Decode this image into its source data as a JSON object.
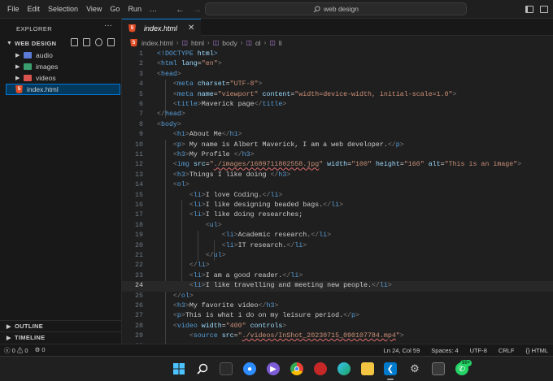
{
  "menu": [
    "File",
    "Edit",
    "Selection",
    "View",
    "Go",
    "Run",
    "…"
  ],
  "search": {
    "text": "web design"
  },
  "sidebar": {
    "title": "EXPLORER",
    "more": "···",
    "workspace": "WEB DESIGN",
    "items": [
      {
        "label": "audio"
      },
      {
        "label": "images"
      },
      {
        "label": "videos"
      },
      {
        "label": "index.html"
      }
    ],
    "outline": "OUTLINE",
    "timeline": "TIMELINE"
  },
  "editor": {
    "tab_title": "index.html",
    "breadcrumb": [
      "index.html",
      "html",
      "body",
      "ol",
      "li"
    ]
  },
  "code": [
    {
      "n": "1",
      "html": "<span class=\"tag\">&lt;!DOCTYPE</span> <span class=\"attr\">html</span><span class=\"tag\">&gt;</span>"
    },
    {
      "n": "2",
      "html": "<span class=\"punc\">&lt;</span><span class=\"tag\">html</span> <span class=\"attr\">lang</span>=<span class=\"str\">\"en\"</span><span class=\"punc\">&gt;</span>"
    },
    {
      "n": "3",
      "html": "<span class=\"punc\">&lt;</span><span class=\"tag\">head</span><span class=\"punc\">&gt;</span>"
    },
    {
      "n": "4",
      "html": "    <span class=\"punc\">&lt;</span><span class=\"tag\">meta</span> <span class=\"attr\">charset</span>=<span class=\"str\">\"UTF-8\"</span><span class=\"punc\">&gt;</span>"
    },
    {
      "n": "5",
      "html": "    <span class=\"punc\">&lt;</span><span class=\"tag\">meta</span> <span class=\"attr\">name</span>=<span class=\"str\">\"viewport\"</span> <span class=\"attr\">content</span>=<span class=\"str\">\"width=device-width, initial-scale=1.0\"</span><span class=\"punc\">&gt;</span>"
    },
    {
      "n": "6",
      "html": "    <span class=\"punc\">&lt;</span><span class=\"tag\">title</span><span class=\"punc\">&gt;</span>Maverick page<span class=\"punc\">&lt;/</span><span class=\"tag\">title</span><span class=\"punc\">&gt;</span>"
    },
    {
      "n": "7",
      "html": "<span class=\"punc\">&lt;/</span><span class=\"tag\">head</span><span class=\"punc\">&gt;</span>"
    },
    {
      "n": "8",
      "html": "<span class=\"punc\">&lt;</span><span class=\"tag\">body</span><span class=\"punc\">&gt;</span>"
    },
    {
      "n": "9",
      "html": "    <span class=\"punc\">&lt;</span><span class=\"tag\">h1</span><span class=\"punc\">&gt;</span>About Me<span class=\"punc\">&lt;/</span><span class=\"tag\">h1</span><span class=\"punc\">&gt;</span>"
    },
    {
      "n": "10",
      "html": "    <span class=\"punc\">&lt;</span><span class=\"tag\">p</span><span class=\"punc\">&gt;</span> My name is Albert Maverick, I am a web developer.<span class=\"punc\">&lt;/</span><span class=\"tag\">p</span><span class=\"punc\">&gt;</span>"
    },
    {
      "n": "11",
      "html": "    <span class=\"punc\">&lt;</span><span class=\"tag\">h3</span><span class=\"punc\">&gt;</span>My Profile <span class=\"punc\">&lt;/</span><span class=\"tag\">h3</span><span class=\"punc\">&gt;</span>"
    },
    {
      "n": "12",
      "html": "    <span class=\"punc\">&lt;</span><span class=\"tag\">img</span> <span class=\"attr\">src</span>=<span class=\"str\">\"<span class=\"wavy\">./images/1689711802558.jpg</span>\"</span> <span class=\"attr\">width</span>=<span class=\"str\">\"100\"</span> <span class=\"attr\">height</span>=<span class=\"str\">\"160\"</span> <span class=\"attr\">alt</span>=<span class=\"str\">\"This is an image\"</span><span class=\"punc\">&gt;</span>"
    },
    {
      "n": "13",
      "html": "    <span class=\"punc\">&lt;</span><span class=\"tag\">h3</span><span class=\"punc\">&gt;</span>Things I like doing <span class=\"punc\">&lt;/</span><span class=\"tag\">h3</span><span class=\"punc\">&gt;</span>"
    },
    {
      "n": "14",
      "html": "    <span class=\"punc\">&lt;</span><span class=\"tag\">ol</span><span class=\"punc\">&gt;</span>"
    },
    {
      "n": "15",
      "html": "        <span class=\"punc\">&lt;</span><span class=\"tag\">li</span><span class=\"punc\">&gt;</span>I love Coding.<span class=\"punc\">&lt;/</span><span class=\"tag\">li</span><span class=\"punc\">&gt;</span>"
    },
    {
      "n": "16",
      "html": "        <span class=\"punc\">&lt;</span><span class=\"tag\">li</span><span class=\"punc\">&gt;</span>I like designing beaded bags.<span class=\"punc\">&lt;/</span><span class=\"tag\">li</span><span class=\"punc\">&gt;</span>"
    },
    {
      "n": "17",
      "html": "        <span class=\"punc\">&lt;</span><span class=\"tag\">li</span><span class=\"punc\">&gt;</span>I like doing researches;"
    },
    {
      "n": "18",
      "html": "            <span class=\"punc\">&lt;</span><span class=\"tag\">ul</span><span class=\"punc\">&gt;</span>"
    },
    {
      "n": "19",
      "html": "                <span class=\"punc\">&lt;</span><span class=\"tag\">li</span><span class=\"punc\">&gt;</span>Academic research.<span class=\"punc\">&lt;/</span><span class=\"tag\">li</span><span class=\"punc\">&gt;</span>"
    },
    {
      "n": "20",
      "html": "                <span class=\"punc\">&lt;</span><span class=\"tag\">li</span><span class=\"punc\">&gt;</span>IT research.<span class=\"punc\">&lt;/</span><span class=\"tag\">li</span><span class=\"punc\">&gt;</span>"
    },
    {
      "n": "21",
      "html": "            <span class=\"punc\">&lt;/</span><span class=\"tag\">ul</span><span class=\"punc\">&gt;</span>"
    },
    {
      "n": "22",
      "html": "        <span class=\"punc\">&lt;/</span><span class=\"tag\">li</span><span class=\"punc\">&gt;</span>"
    },
    {
      "n": "23",
      "html": "        <span class=\"punc\">&lt;</span><span class=\"tag\">li</span><span class=\"punc\">&gt;</span>I am a good reader.<span class=\"punc\">&lt;/</span><span class=\"tag\">li</span><span class=\"punc\">&gt;</span>"
    },
    {
      "n": "24",
      "html": "        <span class=\"punc\">&lt;</span><span class=\"tag\">li</span><span class=\"punc\">&gt;</span>I like travelling and meeting new people.<span class=\"punc\">&lt;/</span><span class=\"tag\">li</span><span class=\"punc\">&gt;</span>",
      "active": true
    },
    {
      "n": "25",
      "html": "    <span class=\"punc\">&lt;/</span><span class=\"tag\">ol</span><span class=\"punc\">&gt;</span>"
    },
    {
      "n": "26",
      "html": "    <span class=\"punc\">&lt;</span><span class=\"tag\">h3</span><span class=\"punc\">&gt;</span>My favorite video<span class=\"punc\">&lt;/</span><span class=\"tag\">h3</span><span class=\"punc\">&gt;</span>"
    },
    {
      "n": "27",
      "html": "    <span class=\"punc\">&lt;</span><span class=\"tag\">p</span><span class=\"punc\">&gt;</span>This is what i do on my leisure period.<span class=\"punc\">&lt;/</span><span class=\"tag\">p</span><span class=\"punc\">&gt;</span>"
    },
    {
      "n": "28",
      "html": "    <span class=\"punc\">&lt;</span><span class=\"tag\">video</span> <span class=\"attr\">width</span>=<span class=\"str\">\"400\"</span> <span class=\"attr\">controls</span><span class=\"punc\">&gt;</span>"
    },
    {
      "n": "29",
      "html": "        <span class=\"punc\">&lt;</span><span class=\"tag\">source</span> <span class=\"attr\">src</span>=<span class=\"str\">\"<span class=\"wavy\">./videos/InShot_20230715_090107784.mp4</span>\"</span><span class=\"punc\">&gt;</span>"
    },
    {
      "n": "30",
      "html": ""
    }
  ],
  "status": {
    "errors": "ⓧ 0 ⚠ 0",
    "ports": "⚙ 0",
    "position": "Ln 24, Col 59",
    "spaces": "Spaces: 4",
    "encoding": "UTF-8",
    "eol": "CRLF",
    "language": "{} HTML",
    "notifications": "⌐"
  },
  "taskbar": {
    "icons": [
      "windows-start",
      "search",
      "file-explorer",
      "zoom",
      "video",
      "chrome",
      "edge",
      "explorer-folder",
      "vscode",
      "settings",
      "store",
      "whatsapp"
    ],
    "badge": "99+"
  }
}
